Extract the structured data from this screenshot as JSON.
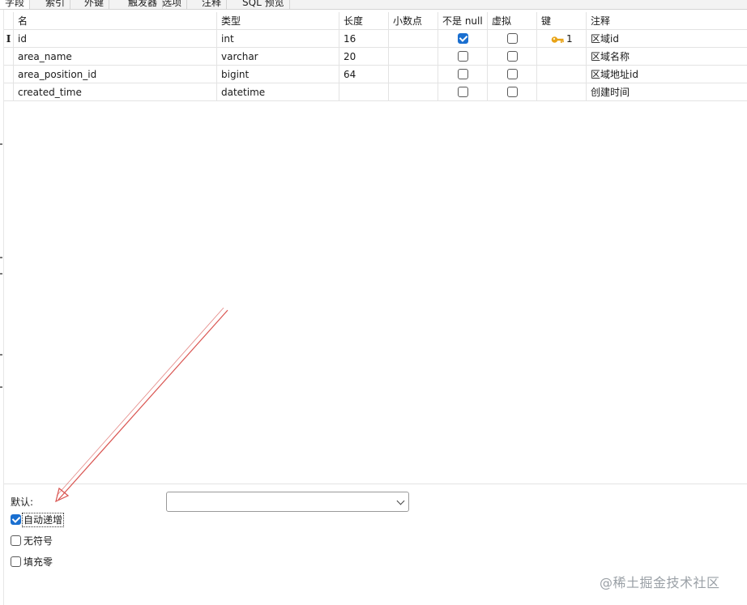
{
  "tabs": [
    "字段",
    "索引",
    "外键",
    "触发器",
    "选项",
    "注释",
    "SQL 预览"
  ],
  "columns": {
    "name": "名",
    "type": "类型",
    "length": "长度",
    "decimal": "小数点",
    "not_null": "不是 null",
    "virtual": "虚拟",
    "key": "键",
    "comment": "注释"
  },
  "rows": [
    {
      "indicator": "I",
      "name": "id",
      "type": "int",
      "length": "16",
      "decimal": "",
      "not_null": true,
      "virtual": false,
      "key": "1",
      "comment": "区域id"
    },
    {
      "indicator": "",
      "name": "area_name",
      "type": "varchar",
      "length": "20",
      "decimal": "",
      "not_null": false,
      "virtual": false,
      "key": "",
      "comment": "区域名称"
    },
    {
      "indicator": "",
      "name": "area_position_id",
      "type": "bigint",
      "length": "64",
      "decimal": "",
      "not_null": false,
      "virtual": false,
      "key": "",
      "comment": "区域地址id"
    },
    {
      "indicator": "",
      "name": "created_time",
      "type": "datetime",
      "length": "",
      "decimal": "",
      "not_null": false,
      "virtual": false,
      "key": "",
      "comment": "创建时间"
    }
  ],
  "bottom": {
    "default_label": "默认:",
    "default_value": "",
    "auto_increment_label": "自动递增",
    "auto_increment_checked": true,
    "unsigned_label": "无符号",
    "unsigned_checked": false,
    "zerofill_label": "填充零",
    "zerofill_checked": false
  },
  "watermark": "@稀土掘金技术社区",
  "colors": {
    "accent": "#1a6fd0",
    "annotation_arrow": "#d9534f",
    "key_icon": "#e8a317",
    "grid_line": "#e3e3e3"
  },
  "icons": {
    "primary_key": "key-icon",
    "dropdown": "chevron-down-icon"
  }
}
